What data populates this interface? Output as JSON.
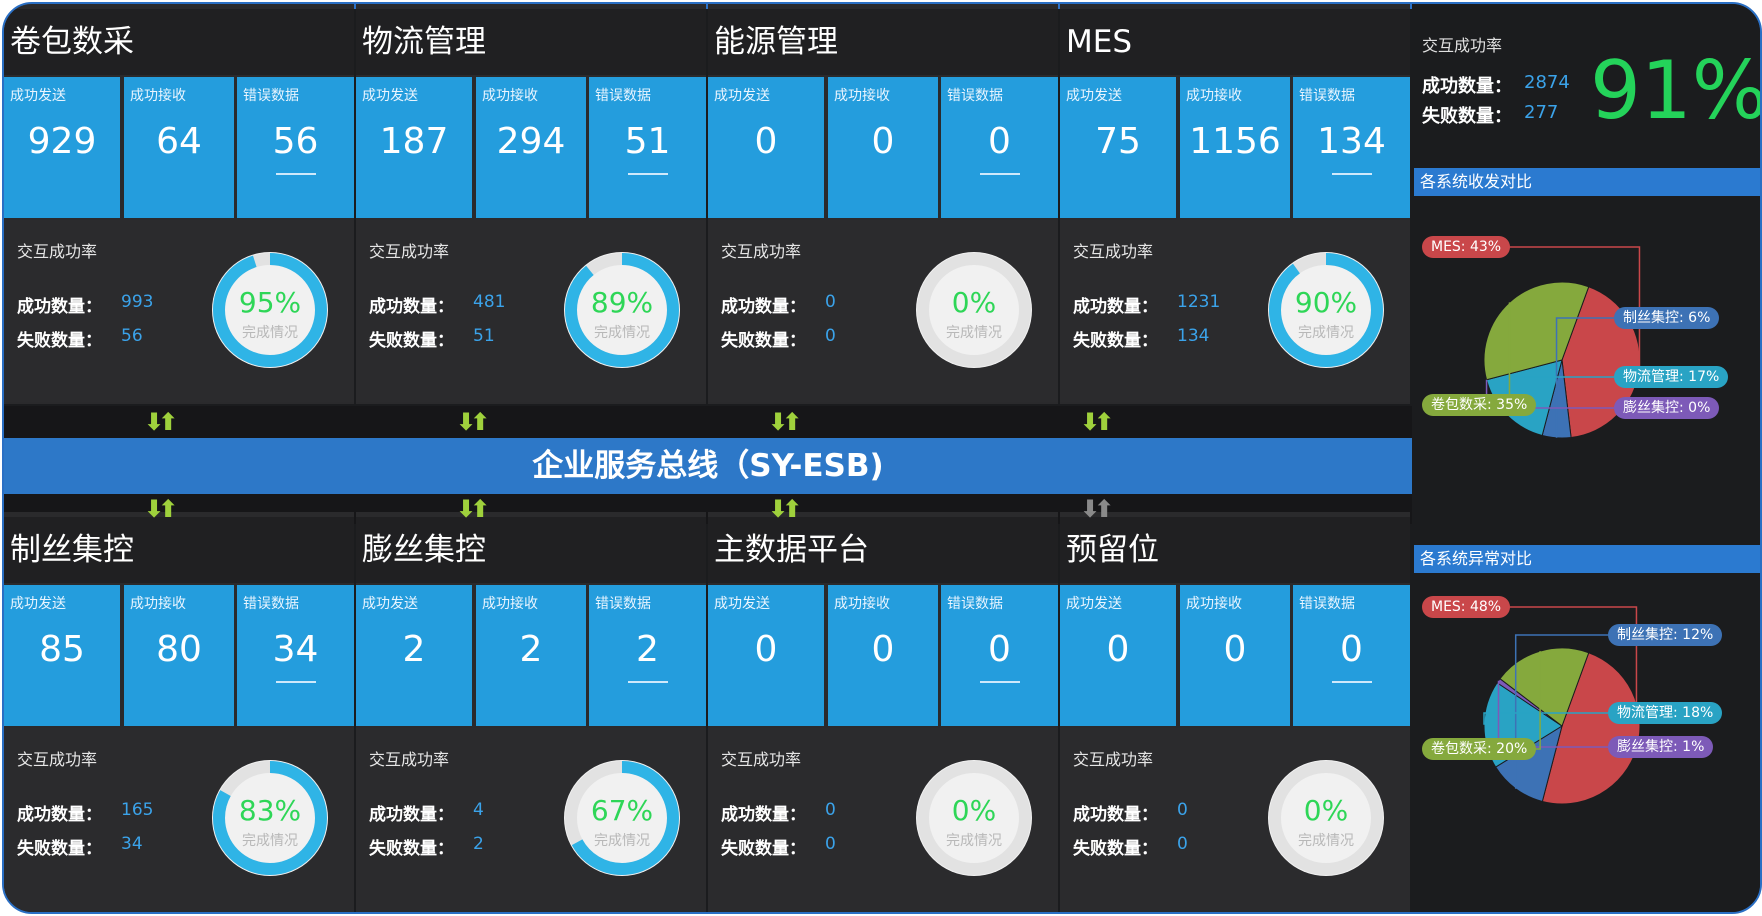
{
  "systems": [
    {
      "name": "卷包数采",
      "send": "929",
      "recv": "64",
      "err": "56",
      "ok": "993",
      "fail": "56",
      "rate": "95%",
      "pct": 95
    },
    {
      "name": "物流管理",
      "send": "187",
      "recv": "294",
      "err": "51",
      "ok": "481",
      "fail": "51",
      "rate": "89%",
      "pct": 89
    },
    {
      "name": "能源管理",
      "send": "0",
      "recv": "0",
      "err": "0",
      "ok": "0",
      "fail": "0",
      "rate": "0%",
      "pct": 0
    },
    {
      "name": "MES",
      "send": "75",
      "recv": "1156",
      "err": "134",
      "ok": "1231",
      "fail": "134",
      "rate": "90%",
      "pct": 90
    },
    {
      "name": "制丝集控",
      "send": "85",
      "recv": "80",
      "err": "34",
      "ok": "165",
      "fail": "34",
      "rate": "83%",
      "pct": 83
    },
    {
      "name": "膨丝集控",
      "send": "2",
      "recv": "2",
      "err": "2",
      "ok": "4",
      "fail": "2",
      "rate": "67%",
      "pct": 67
    },
    {
      "name": "主数据平台",
      "send": "0",
      "recv": "0",
      "err": "0",
      "ok": "0",
      "fail": "0",
      "rate": "0%",
      "pct": 0
    },
    {
      "name": "预留位",
      "send": "0",
      "recv": "0",
      "err": "0",
      "ok": "0",
      "fail": "0",
      "rate": "0%",
      "pct": 0
    }
  ],
  "labels": {
    "send": "成功发送",
    "recv": "成功接收",
    "err": "错误数据",
    "rate_title": "交互成功率",
    "ok": "成功数量：",
    "fail": "失败数量：",
    "done": "完成情况"
  },
  "bus": {
    "title": "企业服务总线（SY-ESB)"
  },
  "arrow_glyph": "⬇⬆",
  "colors": {
    "accent": "#249ddd",
    "bus": "#2d78c8",
    "green": "#2ed657",
    "arrow_active": "#9fd13c",
    "arrow_inactive": "#8a8a8a",
    "ring": "#2fb4e6"
  },
  "arrows_top": [
    true,
    true,
    true,
    true
  ],
  "arrows_bottom": [
    true,
    true,
    true,
    false
  ],
  "summary": {
    "title": "交互成功率",
    "ok_label": "成功数量：",
    "ok": "2874",
    "fail_label": "失败数量：",
    "fail": "277",
    "rate": "91%"
  },
  "send_recv_compare": {
    "title": "各系统收发对比",
    "slices": [
      {
        "label": "MES: 43%",
        "value": 43,
        "color": "#c9474a"
      },
      {
        "label": "制丝集控: 6%",
        "value": 6,
        "color": "#3d72b5"
      },
      {
        "label": "物流管理: 17%",
        "value": 17,
        "color": "#29a3c4"
      },
      {
        "label": "膨丝集控: 0%",
        "value": 0,
        "color": "#7d5ab8"
      },
      {
        "label": "卷包数采: 35%",
        "value": 35,
        "color": "#85a93d"
      }
    ]
  },
  "error_compare": {
    "title": "各系统异常对比",
    "slices": [
      {
        "label": "MES: 48%",
        "value": 48,
        "color": "#c9474a"
      },
      {
        "label": "制丝集控: 12%",
        "value": 12,
        "color": "#3d72b5"
      },
      {
        "label": "物流管理: 18%",
        "value": 18,
        "color": "#29a3c4"
      },
      {
        "label": "膨丝集控: 1%",
        "value": 1,
        "color": "#7d5ab8"
      },
      {
        "label": "卷包数采: 20%",
        "value": 20,
        "color": "#85a93d"
      }
    ]
  }
}
